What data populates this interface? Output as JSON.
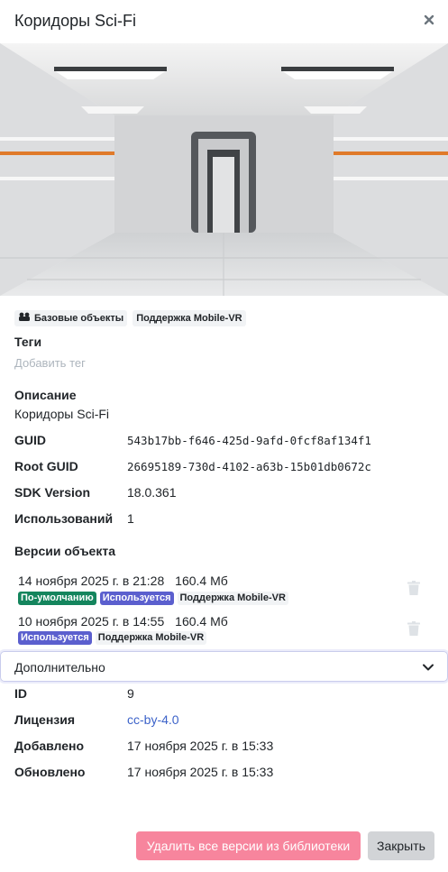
{
  "modal": {
    "title": "Коридоры Sci-Fi"
  },
  "hero": {
    "alt": "sci-fi corridor preview"
  },
  "categories": [
    {
      "label": "Базовые объекты",
      "icon": "objects-icon"
    },
    {
      "label": "Поддержка Mobile-VR"
    }
  ],
  "tags": {
    "label": "Теги",
    "add_placeholder": "Добавить тег"
  },
  "description": {
    "label": "Описание",
    "value": "Коридоры Sci-Fi"
  },
  "info": {
    "guid_label": "GUID",
    "guid": "543b17bb-f646-425d-9afd-0fcf8af134f1",
    "root_guid_label": "Root GUID",
    "root_guid": "26695189-730d-4102-a63b-15b01db0672c",
    "sdk_label": "SDK Version",
    "sdk": "18.0.361",
    "uses_label": "Использований",
    "uses": "1"
  },
  "versions": {
    "label": "Версии объекта",
    "items": [
      {
        "date": "14 ноября 2025 г. в 21:28",
        "size": "160.4 Мб",
        "badge_default": "По-умолчанию",
        "badge_used": "Используется",
        "badge_platform": "Поддержка Mobile-VR"
      },
      {
        "date": "10 ноября 2025 г. в 14:55",
        "size": "160.4 Мб",
        "badge_used": "Используется",
        "badge_platform": "Поддержка Mobile-VR"
      }
    ]
  },
  "advanced": {
    "label": "Дополнительно",
    "id_label": "ID",
    "id": "9",
    "license_label": "Лицензия",
    "license": "cc-by-4.0",
    "added_label": "Добавлено",
    "added": "17 ноября 2025 г. в 15:33",
    "updated_label": "Обновлено",
    "updated": "17 ноября 2025 г. в 15:33"
  },
  "footer": {
    "delete_label": "Удалить все версии из библиотеки",
    "close_label": "Закрыть"
  },
  "colors": {
    "accent": "#3d63c9",
    "danger": "#f7859d",
    "badge_green": "#14855d",
    "badge_purple": "#5b5fce"
  }
}
